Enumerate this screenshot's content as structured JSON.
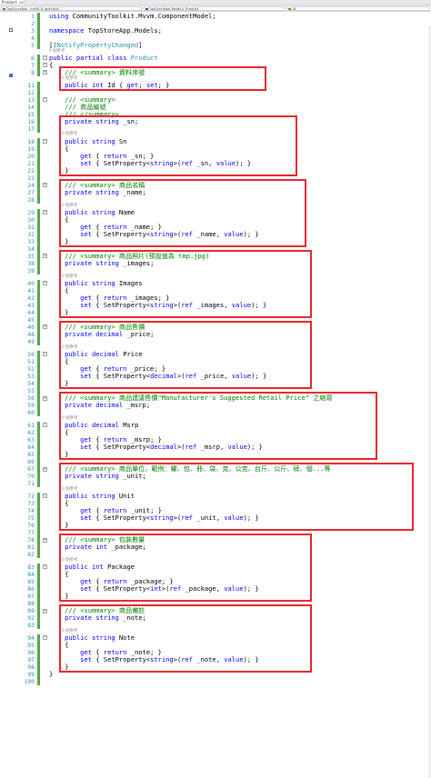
{
  "tabs": {
    "active": "Product.cs*",
    "nav_project": "TopStoreApp (net6.0-android)",
    "nav_class": "TopStoreApp.Models.Product",
    "nav_member": "Id"
  },
  "editor": {
    "ref_label": "0 個參考",
    "colors": {
      "keyword": "#0000ff",
      "type": "#2b91af",
      "comment": "#008000",
      "line_number": "#2b91af",
      "highlight_box": "#e8262c",
      "change_bar": "#57a64a"
    },
    "lines": [
      {
        "n": "1",
        "c": "using CommunityToolkit.Mvvm.ComponentModel;"
      },
      {
        "n": "2",
        "c": ""
      },
      {
        "n": "3",
        "c": "namespace TopStoreApp.Models;"
      },
      {
        "n": "4",
        "c": ""
      },
      {
        "n": "5",
        "c": "[INotifyPropertyChanged]"
      },
      {
        "n": "6",
        "c": "public partial class Product"
      },
      {
        "n": "7",
        "c": "{"
      },
      {
        "n": "8",
        "c": "    /// <summary> 資料序號"
      },
      {
        "n": "11",
        "c": "    public int Id { get; set; }"
      },
      {
        "n": "12",
        "c": ""
      },
      {
        "n": "13",
        "c": "    /// <summary>"
      },
      {
        "n": "14",
        "c": "    /// 商品編號"
      },
      {
        "n": "15",
        "c": "    /// </summary>"
      },
      {
        "n": "16",
        "c": "    private string _sn;"
      },
      {
        "n": "17",
        "c": ""
      },
      {
        "n": "18",
        "c": "    public string Sn"
      },
      {
        "n": "19",
        "c": "    {"
      },
      {
        "n": "20",
        "c": "        get { return _sn; }"
      },
      {
        "n": "21",
        "c": "        set { SetProperty<string>(ref _sn, value); }"
      },
      {
        "n": "22",
        "c": "    }"
      },
      {
        "n": "23",
        "c": ""
      },
      {
        "n": "24",
        "c": "    /// <summary> 商品名稱"
      },
      {
        "n": "27",
        "c": "    private string _name;"
      },
      {
        "n": "28",
        "c": ""
      },
      {
        "n": "29",
        "c": "    public string Name"
      },
      {
        "n": "30",
        "c": "    {"
      },
      {
        "n": "31",
        "c": "        get { return _name; }"
      },
      {
        "n": "32",
        "c": "        set { SetProperty<string>(ref _name, value); }"
      },
      {
        "n": "33",
        "c": "    }"
      },
      {
        "n": "34",
        "c": ""
      },
      {
        "n": "35",
        "c": "    /// <summary> 商品照片(預設值為 tmp.jpg)"
      },
      {
        "n": "38",
        "c": "    private string _images;"
      },
      {
        "n": "39",
        "c": ""
      },
      {
        "n": "40",
        "c": "    public string Images"
      },
      {
        "n": "41",
        "c": "    {"
      },
      {
        "n": "42",
        "c": "        get { return _images; }"
      },
      {
        "n": "43",
        "c": "        set { SetProperty<string>(ref _images, value); }"
      },
      {
        "n": "44",
        "c": "    }"
      },
      {
        "n": "45",
        "c": ""
      },
      {
        "n": "46",
        "c": "    /// <summary> 商品售價"
      },
      {
        "n": "48",
        "c": "    private decimal _price;"
      },
      {
        "n": "49",
        "c": ""
      },
      {
        "n": "50",
        "c": "    public decimal Price"
      },
      {
        "n": "51",
        "c": "    {"
      },
      {
        "n": "52",
        "c": "        get { return _price; }"
      },
      {
        "n": "53",
        "c": "        set { SetProperty<decimal>(ref _price, value); }"
      },
      {
        "n": "54",
        "c": "    }"
      },
      {
        "n": "55",
        "c": ""
      },
      {
        "n": "56",
        "c": "    /// <summary> 商品建議售價\"Manufacturer's Suggested Retail Price\" 之縮寫"
      },
      {
        "n": "59",
        "c": "    private decimal _msrp;"
      },
      {
        "n": "60",
        "c": ""
      },
      {
        "n": "61",
        "c": "    public decimal Msrp"
      },
      {
        "n": "62",
        "c": "    {"
      },
      {
        "n": "63",
        "c": "        get { return _msrp; }"
      },
      {
        "n": "64",
        "c": "        set { SetProperty<decimal>(ref _msrp, value); }"
      },
      {
        "n": "65",
        "c": "    }"
      },
      {
        "n": "66",
        "c": ""
      },
      {
        "n": "67",
        "c": "    /// <summary> 商品單位，範例：罐、包、冊、袋、克、公克、台斤、公斤、磅、個...等"
      },
      {
        "n": "70",
        "c": "    private string _unit;"
      },
      {
        "n": "71",
        "c": ""
      },
      {
        "n": "72",
        "c": "    public string Unit"
      },
      {
        "n": "73",
        "c": "    {"
      },
      {
        "n": "74",
        "c": "        get { return _unit; }"
      },
      {
        "n": "75",
        "c": "        set { SetProperty<string>(ref _unit, value); }"
      },
      {
        "n": "76",
        "c": "    }"
      },
      {
        "n": "77",
        "c": ""
      },
      {
        "n": "78",
        "c": "    /// <summary> 包裝數量"
      },
      {
        "n": "81",
        "c": "    private int _package;"
      },
      {
        "n": "82",
        "c": ""
      },
      {
        "n": "83",
        "c": "    public int Package"
      },
      {
        "n": "84",
        "c": "    {"
      },
      {
        "n": "85",
        "c": "        get { return _package; }"
      },
      {
        "n": "86",
        "c": "        set { SetProperty<int>(ref _package, value); }"
      },
      {
        "n": "87",
        "c": "    }"
      },
      {
        "n": "88",
        "c": ""
      },
      {
        "n": "89",
        "c": "    /// <summary> 商品備註"
      },
      {
        "n": "92",
        "c": "    private string _note;"
      },
      {
        "n": "93",
        "c": ""
      },
      {
        "n": "94",
        "c": "    public string Note"
      },
      {
        "n": "95",
        "c": "    {"
      },
      {
        "n": "96",
        "c": "        get { return _note; }"
      },
      {
        "n": "97",
        "c": "        set { SetProperty<string>(ref _note, value); }"
      },
      {
        "n": "98",
        "c": "    }"
      },
      {
        "n": "99",
        "c": "}"
      },
      {
        "n": "100",
        "c": ""
      }
    ]
  }
}
